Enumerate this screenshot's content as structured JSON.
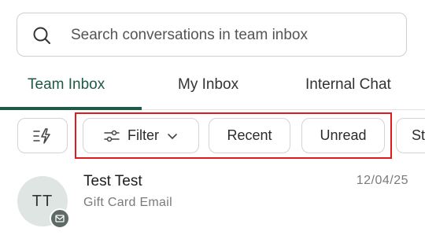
{
  "search": {
    "placeholder": "Search conversations in team inbox",
    "icon": "search-icon"
  },
  "tabs": [
    {
      "label": "Team Inbox",
      "active": true
    },
    {
      "label": "My Inbox",
      "active": false
    },
    {
      "label": "Internal Chat",
      "active": false
    }
  ],
  "filters": {
    "quick_icon": "quick-actions-icon",
    "filter_label": "Filter",
    "filter_icon": "sliders-icon",
    "filter_chevron": "chevron-down-icon",
    "recent_label": "Recent",
    "unread_label": "Unread",
    "status_label": "St"
  },
  "conversations": [
    {
      "initials": "TT",
      "name": "Test Test",
      "subtitle": "Gift Card Email",
      "date": "12/04/25",
      "channel_icon": "email-icon"
    }
  ],
  "colors": {
    "accent": "#1f5a44",
    "highlight": "#e01b1b",
    "avatar_bg": "#dfe5e2",
    "badge_bg": "#5d6a66"
  }
}
